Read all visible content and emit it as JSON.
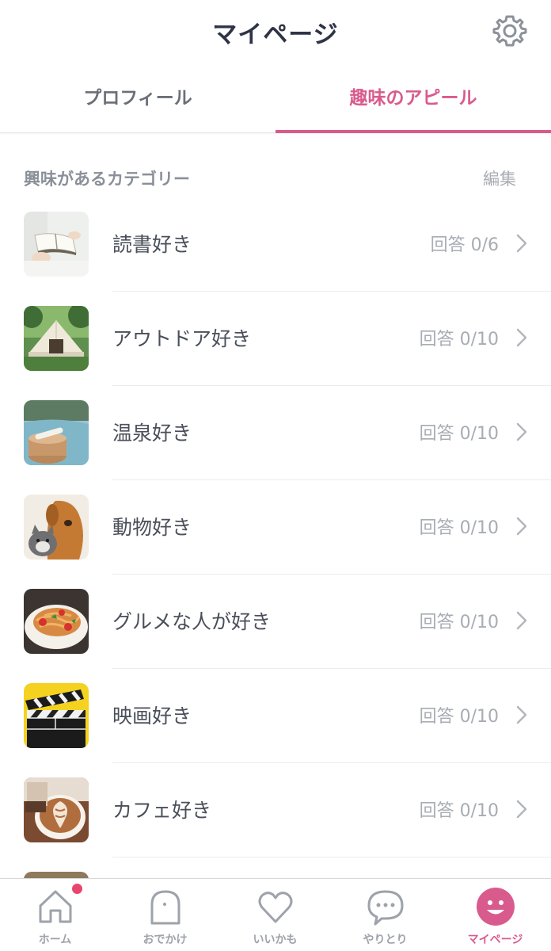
{
  "header": {
    "title": "マイページ",
    "settings_icon": "gear-icon"
  },
  "tabs": [
    {
      "label": "プロフィール",
      "active": false
    },
    {
      "label": "趣味のアピール",
      "active": true
    }
  ],
  "section": {
    "title": "興味があるカテゴリー",
    "edit_label": "編集"
  },
  "categories": [
    {
      "label": "読書好き",
      "answers": "回答 0/6",
      "thumb": "reading"
    },
    {
      "label": "アウトドア好き",
      "answers": "回答 0/10",
      "thumb": "outdoor-tent"
    },
    {
      "label": "温泉好き",
      "answers": "回答 0/10",
      "thumb": "hot-spring"
    },
    {
      "label": "動物好き",
      "answers": "回答 0/10",
      "thumb": "dog-and-cat"
    },
    {
      "label": "グルメな人が好き",
      "answers": "回答 0/10",
      "thumb": "pasta"
    },
    {
      "label": "映画好き",
      "answers": "回答 0/10",
      "thumb": "clapperboard"
    },
    {
      "label": "カフェ好き",
      "answers": "回答 0/10",
      "thumb": "latte-art"
    }
  ],
  "tabbar": [
    {
      "label": "ホーム",
      "icon": "home-icon",
      "active": false,
      "notification": true
    },
    {
      "label": "おでかけ",
      "icon": "ghost-icon",
      "active": false
    },
    {
      "label": "いいかも",
      "icon": "heart-icon",
      "active": false
    },
    {
      "label": "やりとり",
      "icon": "chat-bubble-icon",
      "active": false
    },
    {
      "label": "マイページ",
      "icon": "smiley-icon",
      "active": true
    }
  ],
  "colors": {
    "accent": "#d95b8d",
    "title": "#2e3445",
    "muted": "#a8acb3",
    "badge": "#e8466f"
  }
}
